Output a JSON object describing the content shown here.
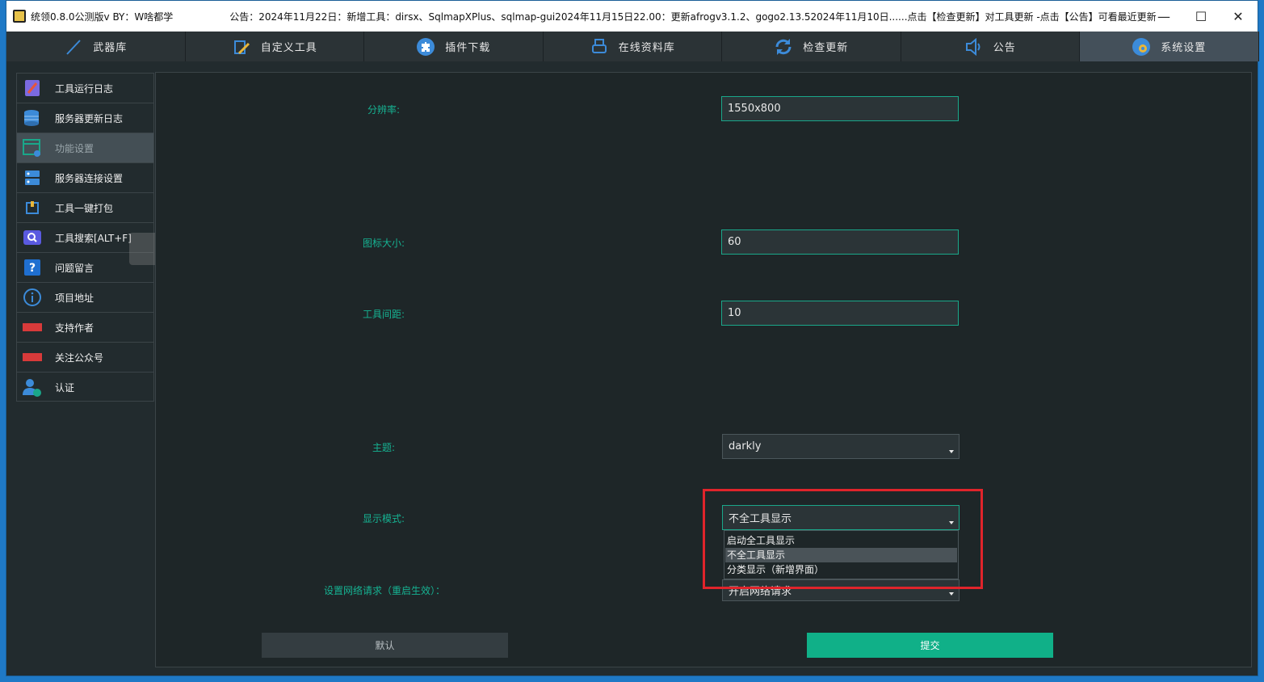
{
  "titlebar": {
    "title": "统领0.8.0公测版v  BY：W啥都学",
    "notice": "公告：2024年11月22日：新增工具：dirsx、SqlmapXPlus、sqlmap-gui2024年11月15日22.00：更新afrogv3.1.2、gogo2.13.52024年11月10日......点击【检查更新】对工具更新   -点击【公告】可看最近更新",
    "minimize": "—",
    "maximize": "☐",
    "close": "✕"
  },
  "tabs": [
    {
      "label": "武器库",
      "icon": "pen-line-icon",
      "active": false
    },
    {
      "label": "自定义工具",
      "icon": "edit-doc-icon",
      "active": false
    },
    {
      "label": "插件下载",
      "icon": "puzzle-icon",
      "active": false
    },
    {
      "label": "在线资料库",
      "icon": "printer-icon",
      "active": false
    },
    {
      "label": "检查更新",
      "icon": "refresh-icon",
      "active": false
    },
    {
      "label": "公告",
      "icon": "speaker-icon",
      "active": false
    },
    {
      "label": "系统设置",
      "icon": "settings-globe-icon",
      "active": true
    }
  ],
  "sidebar": {
    "items": [
      {
        "label": "工具运行日志",
        "icon": "notebook-icon"
      },
      {
        "label": "服务器更新日志",
        "icon": "database-icon"
      },
      {
        "label": "功能设置",
        "icon": "window-gear-icon"
      },
      {
        "label": "服务器连接设置",
        "icon": "server-icon"
      },
      {
        "label": "工具一键打包",
        "icon": "package-icon"
      },
      {
        "label": "工具搜索[ALT+F]",
        "icon": "search-icon"
      },
      {
        "label": "问题留言",
        "icon": "question-icon"
      },
      {
        "label": "项目地址",
        "icon": "info-icon"
      },
      {
        "label": "支持作者",
        "icon": "tag-red-icon"
      },
      {
        "label": "关注公众号",
        "icon": "tag-red-icon"
      },
      {
        "label": "认证",
        "icon": "user-check-icon"
      }
    ],
    "active_index": 2
  },
  "form": {
    "resolution": {
      "label": "分辨率:",
      "value": "1550x800"
    },
    "icon_size": {
      "label": "图标大小:",
      "value": "60"
    },
    "tool_spacing": {
      "label": "工具间距:",
      "value": "10"
    },
    "theme": {
      "label": "主题:",
      "value": "darkly"
    },
    "display_mode": {
      "label": "显示模式:",
      "value": "不全工具显示",
      "options": [
        "启动全工具显示",
        "不全工具显示",
        "分类显示（新增界面）"
      ],
      "selected_index": 1
    },
    "network": {
      "label": "设置网络请求（重启生效）：",
      "value": "开启网络请求"
    }
  },
  "buttons": {
    "default": "默认",
    "submit": "提交"
  },
  "colors": {
    "accent": "#16b292",
    "submit_bg": "#10b088",
    "highlight": "#e0242b",
    "background": "#222b2e"
  }
}
